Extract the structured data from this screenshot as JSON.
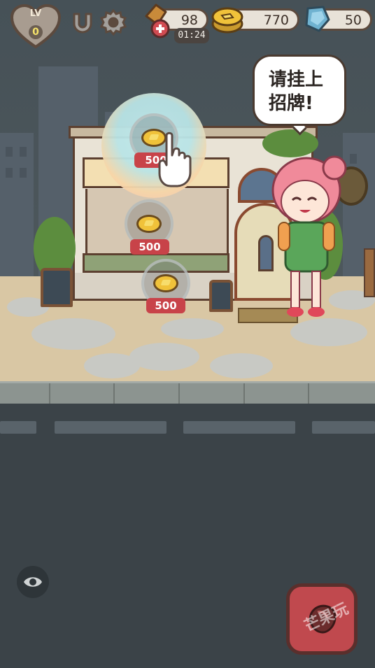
{
  "hud": {
    "level_label": "LV",
    "level_value": "0",
    "energy_value": "98",
    "energy_timer": "01:24",
    "coins_value": "770",
    "gems_value": "50",
    "icons": [
      "heart-icon",
      "magnet-icon",
      "gear-icon",
      "energy-plus-icon",
      "coin-stack-icon",
      "gem-icon"
    ]
  },
  "speech": {
    "line1": "请挂上",
    "line2": "招牌!"
  },
  "purchase_spots": [
    {
      "price": "500"
    },
    {
      "price": "500"
    },
    {
      "price": "500"
    }
  ],
  "watermark": "芒果玩",
  "colors": {
    "price_badge": "#c84349",
    "coin": "#f0c23a",
    "action_button": "#c0494e",
    "road": "#3b4348",
    "sidewalk": "#d9c7a4"
  }
}
